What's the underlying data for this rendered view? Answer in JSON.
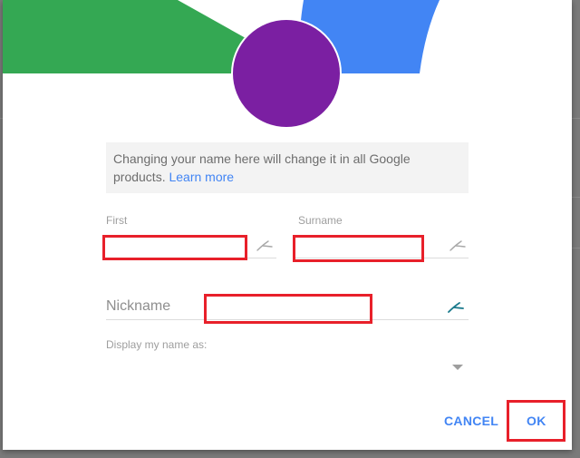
{
  "dialog": {
    "banner": {
      "colors": {
        "green": "#34a853",
        "blue": "#4285f4",
        "avatar": "#7b1fa2"
      }
    },
    "notice": {
      "text": "Changing your name here will change it in all Google products.",
      "link_label": "Learn more"
    },
    "fields": {
      "first": {
        "label": "First",
        "value": ""
      },
      "surname": {
        "label": "Surname",
        "value": ""
      },
      "nickname": {
        "placeholder": "Nickname",
        "value": ""
      }
    },
    "display_name": {
      "label": "Display my name as:",
      "selected": ""
    },
    "actions": {
      "cancel_label": "CANCEL",
      "ok_label": "OK"
    },
    "annotation_color": "#e8202a"
  }
}
